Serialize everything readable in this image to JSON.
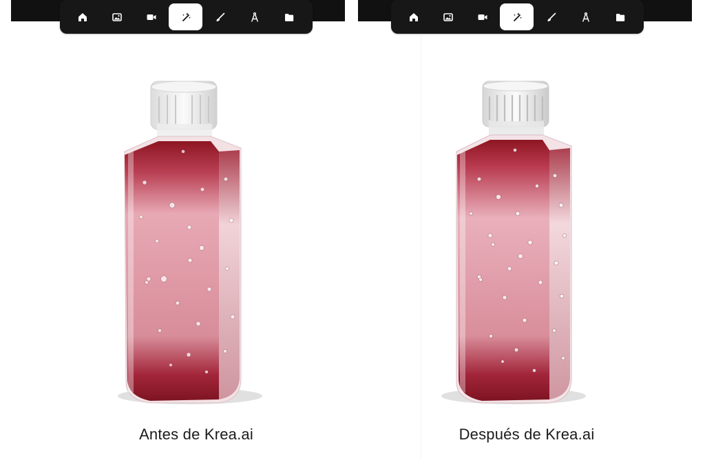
{
  "toolbar": {
    "items": [
      {
        "icon": "home-icon"
      },
      {
        "icon": "image-icon"
      },
      {
        "icon": "video-icon"
      },
      {
        "icon": "magic-wand-icon",
        "active": true
      },
      {
        "icon": "brush-icon"
      },
      {
        "icon": "compass-icon"
      },
      {
        "icon": "folder-icon"
      }
    ]
  },
  "panels": {
    "before_caption": "Antes de Krea.ai",
    "after_caption": "Después de Krea.ai"
  },
  "colors": {
    "toolbar_bg": "#171717",
    "active_tool_bg": "#ffffff",
    "liquid_dark": "#8e1622",
    "liquid_light": "#e7a9b4"
  }
}
